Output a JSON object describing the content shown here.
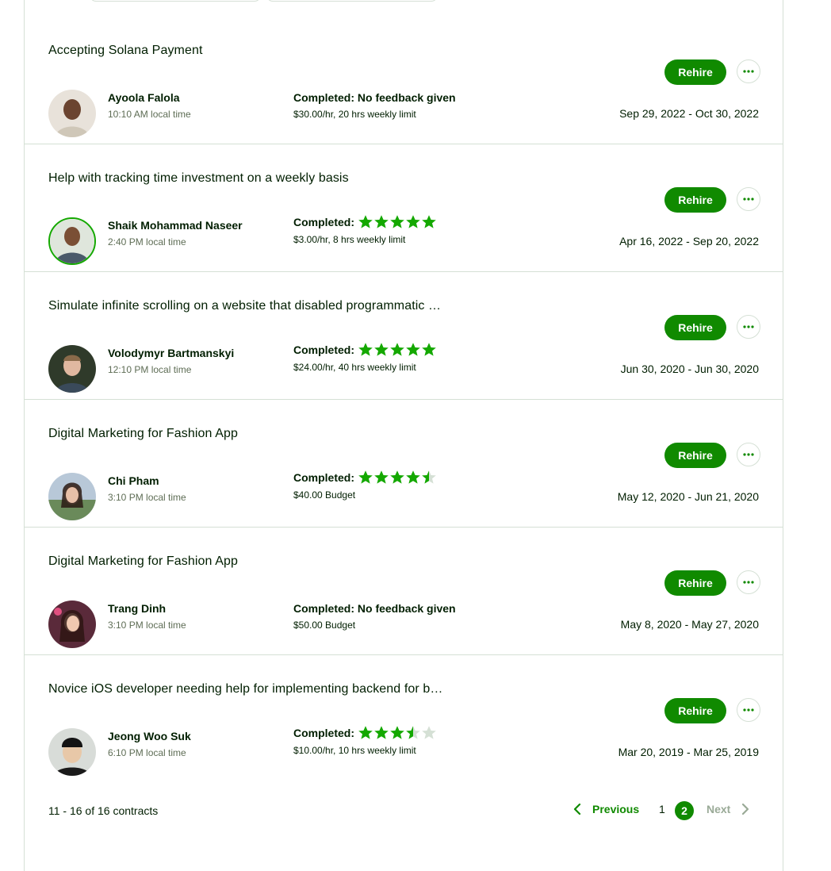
{
  "contracts": [
    {
      "title": "Accepting Solana Payment",
      "name": "Ayoola Falola",
      "local_time": "10:10 AM local time",
      "status": "Completed: No feedback given",
      "rating": null,
      "rate": "$30.00/hr, 20 hrs weekly limit",
      "dates": "Sep 29, 2022 - Oct 30, 2022",
      "rehire": "Rehire"
    },
    {
      "title": "Help with tracking time investment on a weekly basis",
      "name": "Shaik Mohammad Naseer",
      "local_time": "2:40 PM local time",
      "status": "Completed:",
      "rating": 5,
      "rate": "$3.00/hr, 8 hrs weekly limit",
      "dates": "Apr 16, 2022 - Sep 20, 2022",
      "rehire": "Rehire"
    },
    {
      "title": "Simulate infinite scrolling on a website that disabled programmatic …",
      "name": "Volodymyr Bartmanskyi",
      "local_time": "12:10 PM local time",
      "status": "Completed:",
      "rating": 5,
      "rate": "$24.00/hr, 40 hrs weekly limit",
      "dates": "Jun 30, 2020 - Jun 30, 2020",
      "rehire": "Rehire"
    },
    {
      "title": "Digital Marketing for Fashion App",
      "name": "Chi Pham",
      "local_time": "3:10 PM local time",
      "status": "Completed:",
      "rating": 4.5,
      "rate": "$40.00 Budget",
      "dates": "May 12, 2020 - Jun 21, 2020",
      "rehire": "Rehire"
    },
    {
      "title": "Digital Marketing for Fashion App",
      "name": "Trang Dinh",
      "local_time": "3:10 PM local time",
      "status": "Completed: No feedback given",
      "rating": null,
      "rate": "$50.00 Budget",
      "dates": "May 8, 2020 - May 27, 2020",
      "rehire": "Rehire"
    },
    {
      "title": "Novice iOS developer needing help for implementing backend for b…",
      "name": "Jeong Woo Suk",
      "local_time": "6:10 PM local time",
      "status": "Completed:",
      "rating": 3.5,
      "rate": "$10.00/hr, 10 hrs weekly limit",
      "dates": "Mar 20, 2019 - Mar 25, 2019",
      "rehire": "Rehire"
    }
  ],
  "footer": {
    "count": "11 - 16 of 16 contracts"
  },
  "pagination": {
    "previous": "Previous",
    "page1": "1",
    "page2": "2",
    "next": "Next"
  },
  "colors": {
    "accent": "#108a00",
    "star": "#14a800",
    "star_empty": "#d5e0d5",
    "text": "#001e00",
    "muted": "#5e6d55"
  }
}
